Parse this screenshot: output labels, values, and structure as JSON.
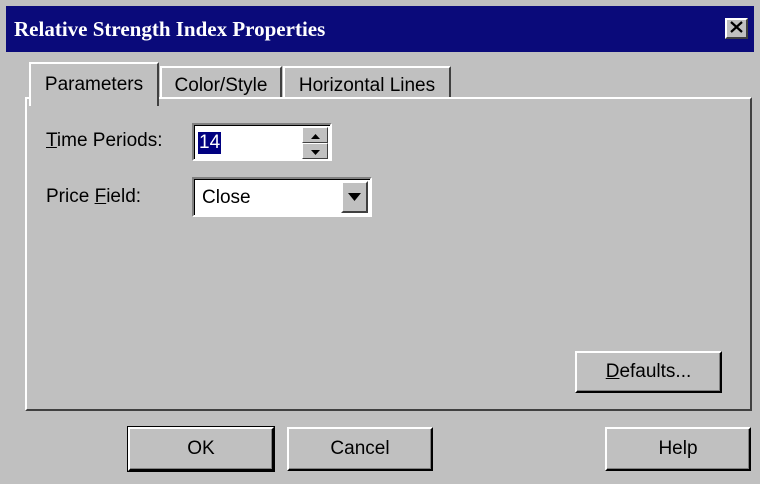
{
  "window": {
    "title": "Relative Strength Index Properties",
    "close_icon": "close-icon"
  },
  "tabs": [
    {
      "label": "Parameters",
      "active": true
    },
    {
      "label": "Color/Style",
      "active": false
    },
    {
      "label": "Horizontal Lines",
      "active": false
    }
  ],
  "parameters": {
    "time_periods": {
      "label_mnemonic": "T",
      "label_rest": "ime Periods:",
      "value": "14"
    },
    "price_field": {
      "label_prefix": "Price ",
      "label_mnemonic": "F",
      "label_rest": "ield:",
      "value": "Close"
    },
    "defaults_button": {
      "mnemonic": "D",
      "rest": "efaults..."
    }
  },
  "buttons": {
    "ok": "OK",
    "cancel": "Cancel",
    "help": "Help"
  },
  "colors": {
    "titlebar": "#0a0a7a",
    "face": "#c0c0c0",
    "selection": "#000080"
  }
}
